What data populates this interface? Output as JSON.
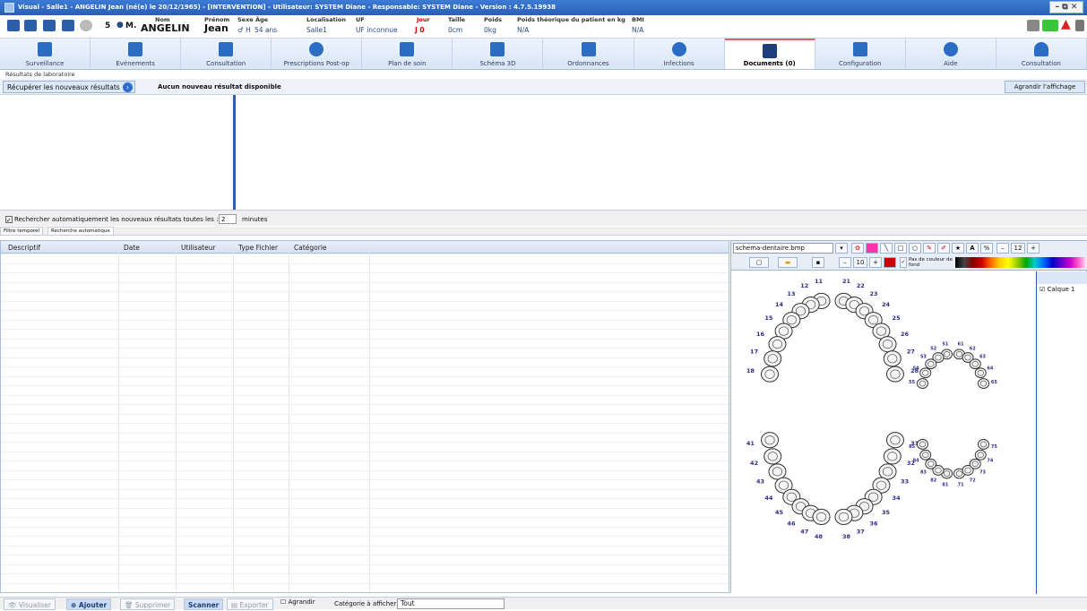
{
  "window": {
    "title": "Visual - Salle1 - ANGELIN Jean (né(e) le 20/12/1965) - [INTERVENTION] - Utilisateur: SYSTEM Diane - Responsable: SYSTEM Diane - Version : 4.7.5.19938",
    "controls": "– ⧉ ✕"
  },
  "patient": {
    "number": "5",
    "civility": "M.",
    "nom_label": "Nom",
    "nom": "ANGELIN",
    "prenom_label": "Prénom",
    "prenom": "Jean",
    "sexe_label": "Sexe",
    "sexe": "H",
    "age_label": "Âge",
    "age": "54 ans",
    "loc_label": "Localisation",
    "loc": "Salle1",
    "uf_label": "UF",
    "uf": "UF inconnue",
    "jour_label": "Jour",
    "jour": "J 0",
    "taille_label": "Taille",
    "taille": "0cm",
    "poids_label": "Poids",
    "poids": "0kg",
    "poids_th_label": "Poids théorique du patient en kg",
    "poids_th": "N/A",
    "bmi_label": "BMI",
    "bmi": "N/A"
  },
  "nav": [
    {
      "label": "Surveillance"
    },
    {
      "label": "Evénements"
    },
    {
      "label": "Consultation"
    },
    {
      "label": "Prescriptions Post-op"
    },
    {
      "label": "Plan de soin"
    },
    {
      "label": "Schéma 3D"
    },
    {
      "label": "Ordonnances"
    },
    {
      "label": "Infections"
    },
    {
      "label": "Documents (0)",
      "active": true
    },
    {
      "label": "Configuration"
    },
    {
      "label": "Aide"
    },
    {
      "label": "Consultation"
    }
  ],
  "lab": {
    "section_label": "Résultats de laboratoire",
    "fetch_button": "Récupérer les nouveaux résultats",
    "message": "Aucun nouveau résultat disponible",
    "enlarge_button": "Agrandir l'affichage"
  },
  "auto": {
    "label": "Rechercher automatiquement les nouveaux résultats toutes les :",
    "value": "2",
    "unit": "minutes",
    "checked": true
  },
  "subtabs": [
    "Filtre temporel",
    "Recherche automatique"
  ],
  "table": {
    "headers": [
      "Descriptif",
      "Date",
      "Utilisateur",
      "Type Fichier",
      "Catégorie"
    ],
    "rows": []
  },
  "drawing": {
    "filename": "schema-dentaire.bmp",
    "pen_size": "10",
    "font_size": "12",
    "bg_option": "Pas de couleur de fond",
    "layer": "Calque 1",
    "accent": "#cc0000"
  },
  "teeth": {
    "upper_right": [
      "11",
      "12",
      "13",
      "14",
      "15",
      "16",
      "17",
      "18"
    ],
    "upper_left": [
      "21",
      "22",
      "23",
      "24",
      "25",
      "26",
      "27",
      "28"
    ],
    "lower_right": [
      "41",
      "42",
      "43",
      "44",
      "45",
      "46",
      "47",
      "48"
    ],
    "lower_left": [
      "31",
      "32",
      "33",
      "34",
      "35",
      "36",
      "37",
      "38"
    ],
    "child_upper": [
      "51",
      "52",
      "53",
      "54",
      "55",
      "61",
      "62",
      "63",
      "64",
      "65"
    ],
    "child_lower": [
      "71",
      "72",
      "73",
      "74",
      "75",
      "81",
      "82",
      "83",
      "84",
      "85"
    ]
  },
  "bottom": {
    "visualiser": "Visualiser",
    "ajouter": "Ajouter",
    "supprimer": "Supprimer",
    "scanner": "Scanner",
    "exporter": "Exporter",
    "agrandir": "Agrandir",
    "cat_label": "Catégorie à afficher:",
    "cat_value": "Tout"
  }
}
